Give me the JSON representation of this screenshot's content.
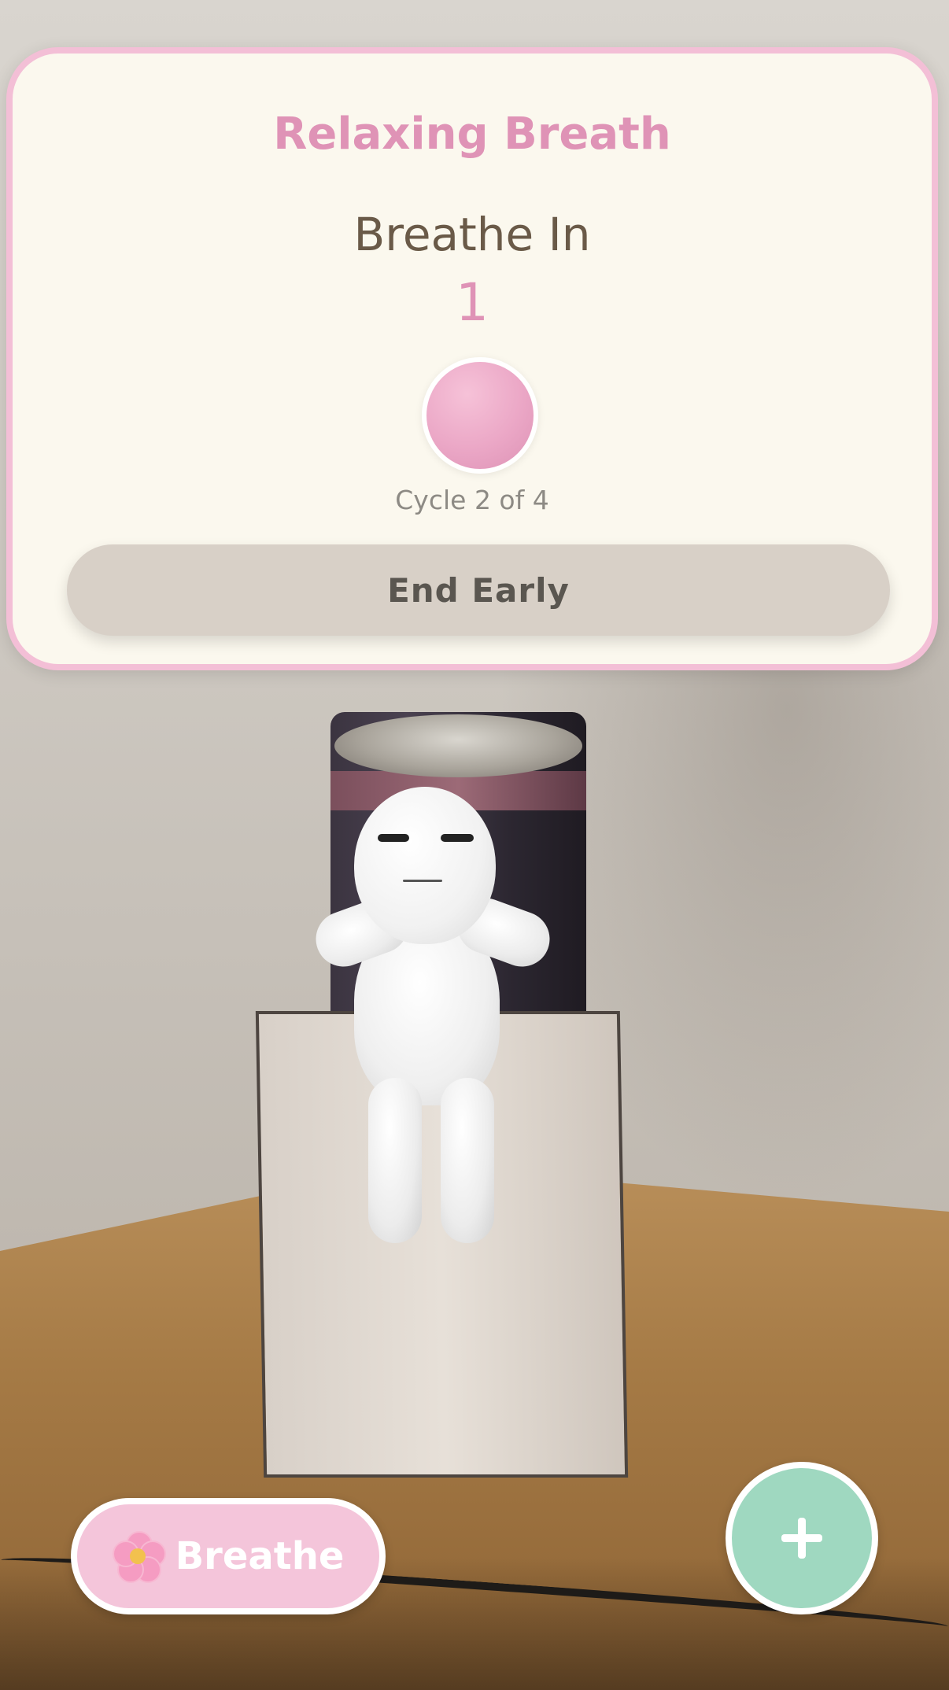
{
  "session_card": {
    "title": "Relaxing Breath",
    "phase": "Breathe In",
    "counter": "1",
    "cycle": "Cycle 2 of 4",
    "end_button": "End Early"
  },
  "controls": {
    "breathe_label": "Breathe",
    "breathe_icon": "cherry-blossom-icon",
    "add_icon": "plus-icon"
  },
  "colors": {
    "accent_pink": "#df93b6",
    "card_border": "#f3bfd6",
    "card_background": "#fbf8ee",
    "end_button_background": "#d8d0c7",
    "breathe_button_background": "#f4c5da",
    "add_button_background": "#9fd8c0"
  }
}
